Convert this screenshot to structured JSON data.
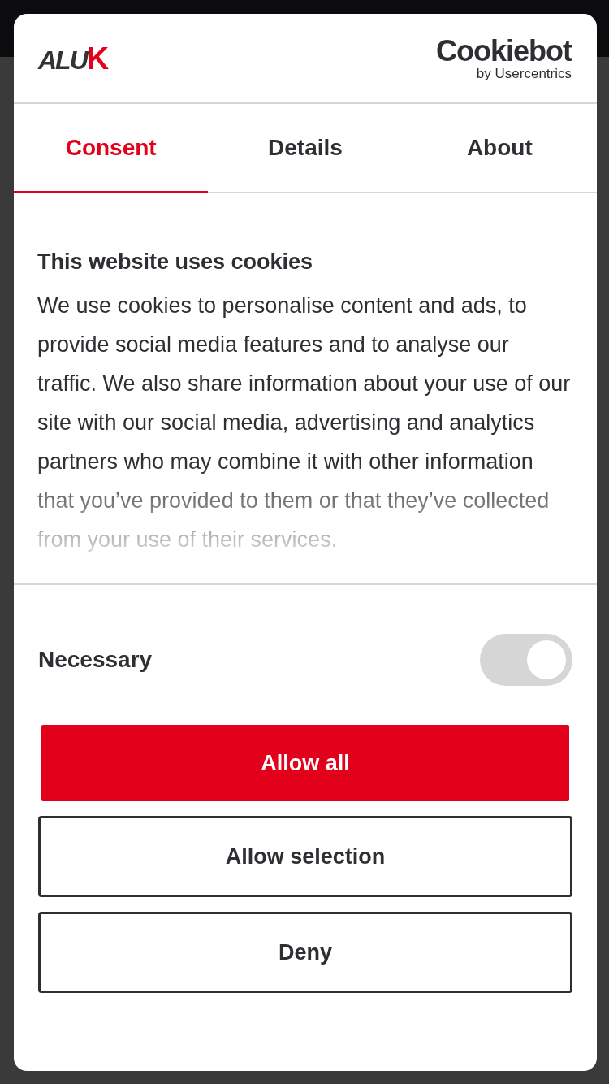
{
  "brand_logo": "ALUK",
  "provider_logo": {
    "name": "Cookiebot",
    "byline": "by Usercentrics"
  },
  "tabs": [
    {
      "label": "Consent",
      "selected": true
    },
    {
      "label": "Details",
      "selected": false
    },
    {
      "label": "About",
      "selected": false
    }
  ],
  "title": "This website uses cookies",
  "description": "We use cookies to personalise content and ads, to provide social media features and to analyse our traffic. We also share information about your use of our site with our social media, advertising and analytics partners who may combine it with other information that you’ve provided to them or that they’ve collected from your use of their services.",
  "categories": [
    {
      "label": "Necessary",
      "on": true,
      "disabled": true
    }
  ],
  "buttons": [
    {
      "label": "Allow all",
      "kind": "primary"
    },
    {
      "label": "Allow selection",
      "kind": "outline"
    },
    {
      "label": "Deny",
      "kind": "outline"
    }
  ]
}
